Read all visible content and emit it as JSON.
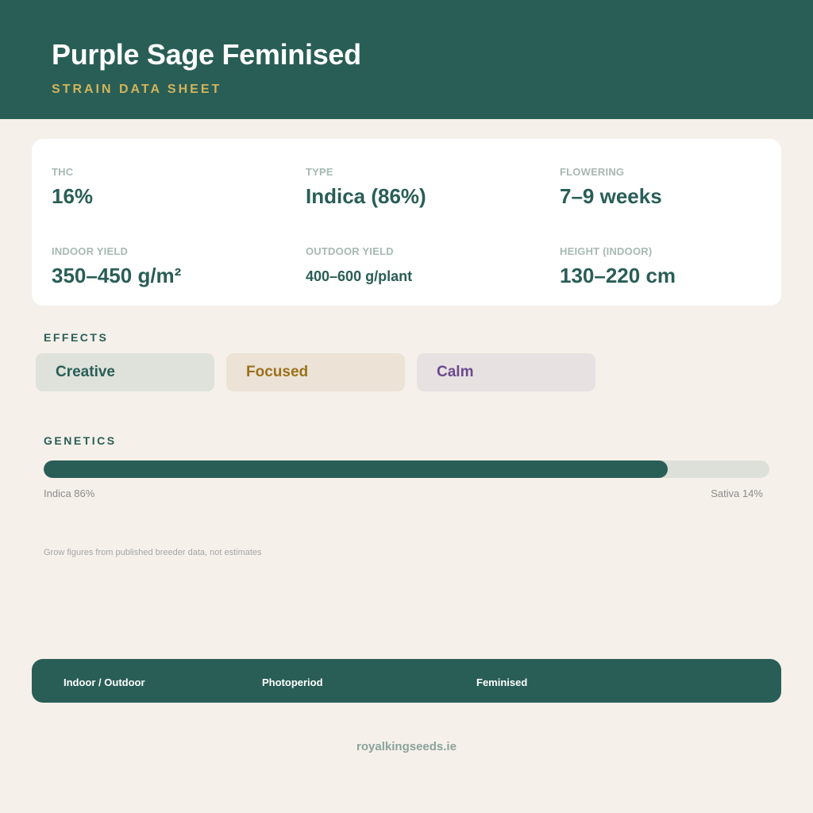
{
  "header": {
    "title": "Purple Sage Feminised",
    "subtitle": "STRAIN DATA SHEET"
  },
  "stats": [
    {
      "label": "THC",
      "value": "16%"
    },
    {
      "label": "TYPE",
      "value": "Indica (86%)"
    },
    {
      "label": "FLOWERING",
      "value": "7–9 weeks"
    },
    {
      "label": "INDOOR YIELD",
      "value": "350–450 g/m²"
    },
    {
      "label": "OUTDOOR YIELD",
      "value": "400–600 g/plant"
    },
    {
      "label": "HEIGHT (INDOOR)",
      "value": "130–220 cm"
    }
  ],
  "effects": {
    "label": "EFFECTS",
    "tags": [
      "Creative",
      "Focused",
      "Calm"
    ]
  },
  "genetics": {
    "label": "GENETICS",
    "indica_percent": 86,
    "indica_label": "Indica 86%",
    "sativa_label": "Sativa 14%"
  },
  "note": "Grow figures from published breeder data, not estimates",
  "footer": {
    "items": [
      "Indoor / Outdoor",
      "Photoperiod",
      "Feminised"
    ],
    "website": "royalkingseeds.ie"
  },
  "colors": {
    "primary": "#295e56",
    "accent": "#d2b45a",
    "background": "#f5f0ea"
  }
}
